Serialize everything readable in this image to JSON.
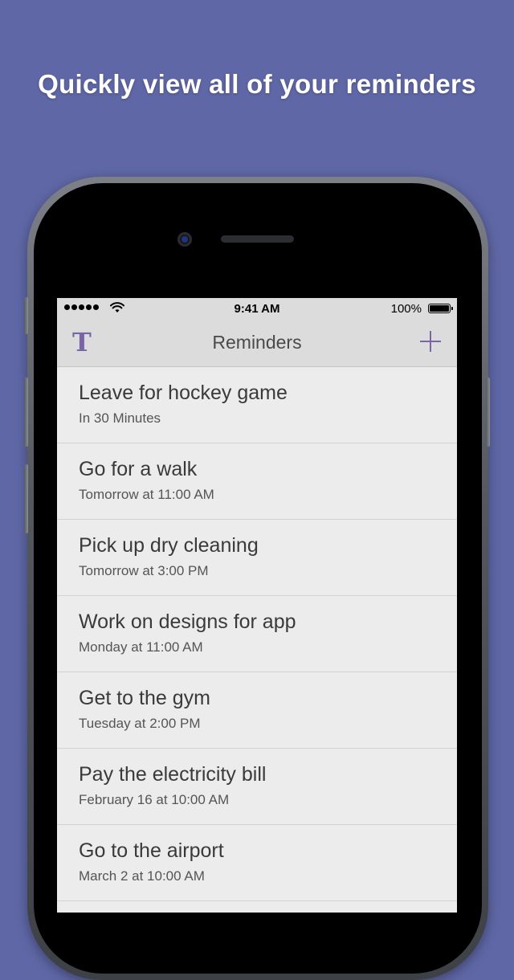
{
  "headline": "Quickly view all of your reminders",
  "colors": {
    "background": "#5f67a6",
    "accent": "#7a65a9",
    "screen_background": "#ececec",
    "nav_background": "#dcdcdc"
  },
  "status_bar": {
    "time": "9:41 AM",
    "battery_percent": "100%",
    "signal_icon": "signal-dots-icon",
    "wifi_icon": "wifi-icon",
    "battery_icon": "battery-icon"
  },
  "nav": {
    "title": "Reminders",
    "logo_letter": "T",
    "add_icon": "plus-icon"
  },
  "reminders": [
    {
      "title": "Leave for hockey game",
      "subtitle": "In 30 Minutes"
    },
    {
      "title": "Go for a walk",
      "subtitle": "Tomorrow at 11:00 AM"
    },
    {
      "title": "Pick up dry cleaning",
      "subtitle": "Tomorrow at 3:00 PM"
    },
    {
      "title": "Work on designs for app",
      "subtitle": "Monday at 11:00 AM"
    },
    {
      "title": "Get to the gym",
      "subtitle": "Tuesday at 2:00 PM"
    },
    {
      "title": "Pay the electricity bill",
      "subtitle": "February 16 at 10:00 AM"
    },
    {
      "title": "Go to the airport",
      "subtitle": "March 2 at 10:00 AM"
    },
    {
      "title": "",
      "subtitle": ""
    }
  ]
}
